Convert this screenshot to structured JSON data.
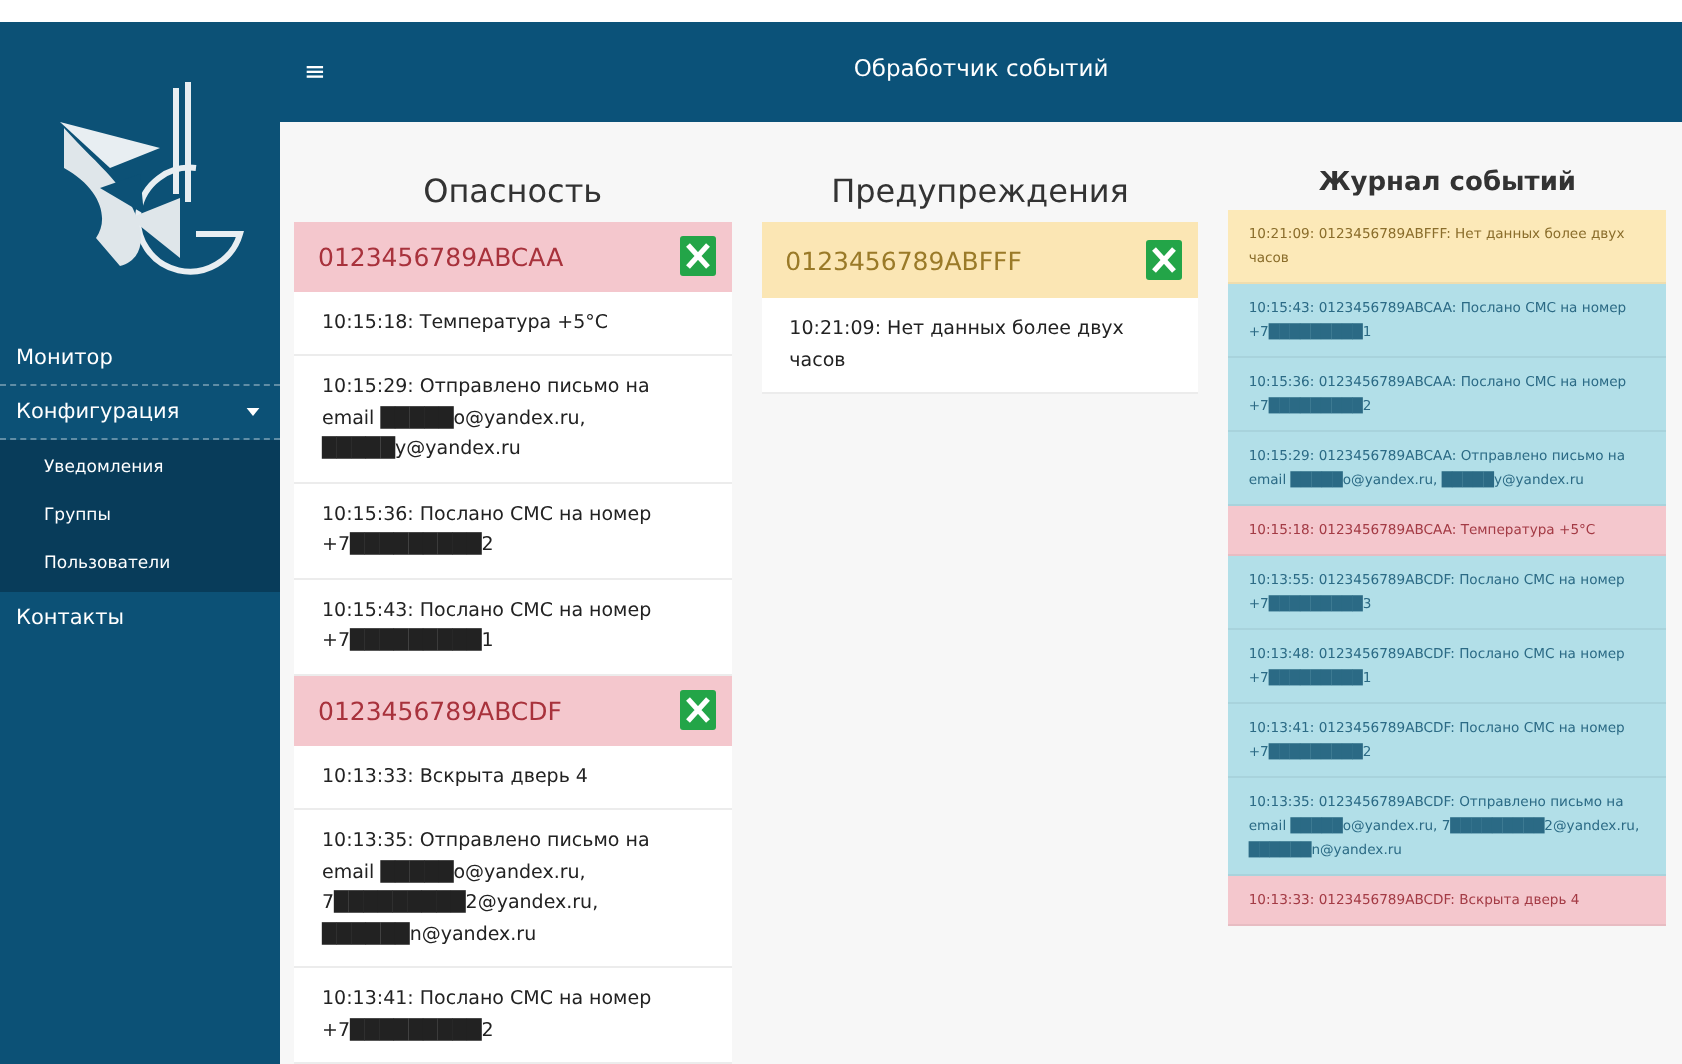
{
  "sidebar": {
    "items": [
      {
        "kind": "link",
        "label": "Монитор"
      },
      {
        "kind": "group",
        "label": "Конфигурация",
        "expanded": true,
        "children": [
          {
            "label": "Уведомления"
          },
          {
            "label": "Группы"
          },
          {
            "label": "Пользователи"
          }
        ]
      },
      {
        "kind": "link",
        "label": "Контакты"
      }
    ]
  },
  "header": {
    "menu_icon": "≡",
    "title": "Обработчик событий"
  },
  "columns": [
    {
      "kind": "danger",
      "title": "Опасность",
      "devices": [
        {
          "id": "0123456789ABCAA",
          "events": [
            "10:15:18: Температура +5°C",
            "10:15:29: Отправлено письмо на email █████o@yandex.ru, █████y@yandex.ru",
            "10:15:36: Послано СМС на номер +7█████████2",
            "10:15:43: Послано СМС на номер +7█████████1"
          ]
        },
        {
          "id": "0123456789ABCDF",
          "events": [
            "10:13:33: Вскрыта дверь 4",
            "10:13:35: Отправлено письмо на email █████o@yandex.ru, 7█████████2@yandex.ru, ██████n@yandex.ru",
            "10:13:41: Послано СМС на номер +7█████████2"
          ]
        }
      ]
    },
    {
      "kind": "warning",
      "title": "Предупреждения",
      "devices": [
        {
          "id": "0123456789ABFFF",
          "events": [
            "10:21:09: Нет данных более двух часов"
          ]
        }
      ]
    }
  ],
  "log": {
    "title": "Журнал событий",
    "entries": [
      {
        "kind": "warning",
        "text": "10:21:09: 0123456789ABFFF: Нет данных более двух часов"
      },
      {
        "kind": "info",
        "text": "10:15:43: 0123456789ABCAA: Послано СМС на номер +7█████████1"
      },
      {
        "kind": "info",
        "text": "10:15:36: 0123456789ABCAA: Послано СМС на номер +7█████████2"
      },
      {
        "kind": "info",
        "text": "10:15:29: 0123456789ABCAA: Отправлено письмо на email █████o@yandex.ru, █████y@yandex.ru"
      },
      {
        "kind": "danger",
        "text": "10:15:18: 0123456789ABCAA: Температура +5°C"
      },
      {
        "kind": "info",
        "text": "10:13:55: 0123456789ABCDF: Послано СМС на номер +7█████████3"
      },
      {
        "kind": "info",
        "text": "10:13:48: 0123456789ABCDF: Послано СМС на номер +7█████████1"
      },
      {
        "kind": "info",
        "text": "10:13:41: 0123456789ABCDF: Послано СМС на номер +7█████████2"
      },
      {
        "kind": "info",
        "text": "10:13:35: 0123456789ABCDF: Отправлено письмо на email █████o@yandex.ru, 7█████████2@yandex.ru, ██████n@yandex.ru"
      },
      {
        "kind": "danger",
        "text": "10:13:33: 0123456789ABCDF: Вскрыта дверь 4"
      }
    ]
  }
}
